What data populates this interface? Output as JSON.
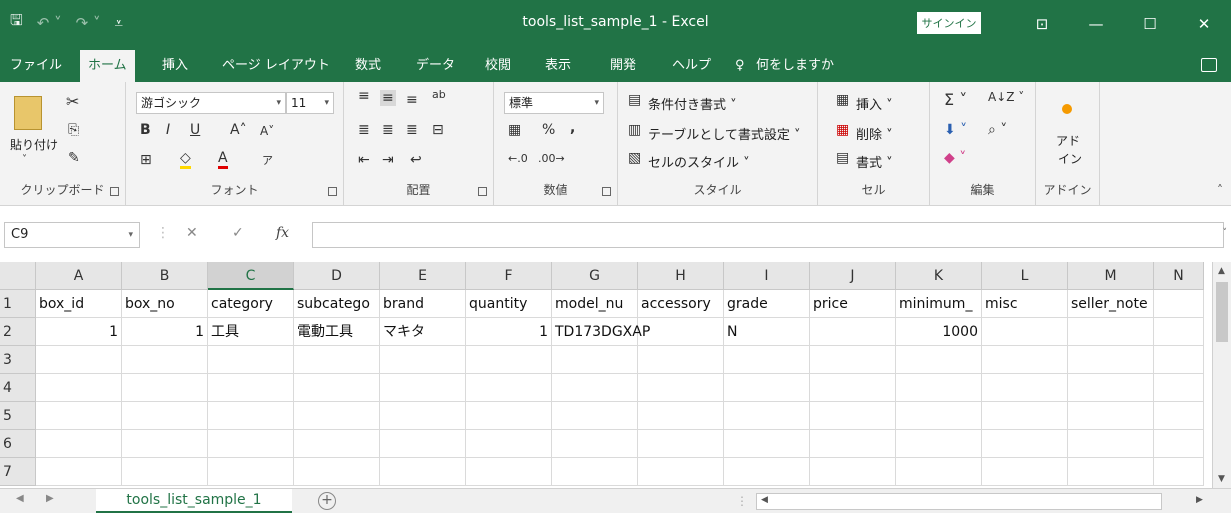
{
  "window": {
    "title": "tools_list_sample_1  -  Excel",
    "signin": "サインイン",
    "min": "—",
    "max": "☐",
    "close": "✕",
    "ribbon_display": "⊡"
  },
  "qat": {
    "save": "🖫",
    "undo": "↶ ˅",
    "redo": "↷ ˅",
    "customize": "⩡"
  },
  "tabs": {
    "file": "ファイル",
    "home": "ホーム",
    "insert": "挿入",
    "page_layout": "ページ レイアウト",
    "formulas": "数式",
    "data": "データ",
    "review": "校閲",
    "view": "表示",
    "developer": "開発",
    "help": "ヘルプ",
    "tell_me": "何をしますか"
  },
  "ribbon": {
    "clipboard": {
      "label": "クリップボード",
      "paste": "貼り付け"
    },
    "font": {
      "label": "フォント",
      "name": "游ゴシック",
      "size": "11"
    },
    "alignment": {
      "label": "配置"
    },
    "number": {
      "label": "数値",
      "format": "標準",
      "percent": "%",
      "comma": ","
    },
    "styles": {
      "label": "スタイル",
      "conditional": "条件付き書式 ˅",
      "as_table": "テーブルとして書式設定 ˅",
      "cell_styles": "セルのスタイル ˅"
    },
    "cells": {
      "label": "セル",
      "insert": "挿入 ˅",
      "delete": "削除 ˅",
      "format": "書式 ˅"
    },
    "editing": {
      "label": "編集"
    },
    "addins": {
      "label": "アドイン",
      "button_line1": "アド",
      "button_line2": "イン"
    }
  },
  "formula_bar": {
    "name_box": "C9",
    "cancel": "✕",
    "enter": "✓",
    "fx": "fx",
    "value": ""
  },
  "columns": [
    "A",
    "B",
    "C",
    "D",
    "E",
    "F",
    "G",
    "H",
    "I",
    "J",
    "K",
    "L",
    "M",
    "N"
  ],
  "rows": [
    "1",
    "2",
    "3",
    "4",
    "5",
    "6",
    "7"
  ],
  "cells": {
    "r1": [
      "box_id",
      "box_no",
      "category",
      "subcatego",
      "brand",
      "quantity",
      "model_nu",
      "accessory",
      "grade",
      "price",
      "minimum_",
      "misc",
      "seller_note",
      ""
    ],
    "r2": [
      "1",
      "1",
      "工具",
      "電動工具",
      "マキタ",
      "1",
      "TD173DGXAP",
      "",
      "N",
      "",
      "1000",
      "",
      "",
      ""
    ]
  },
  "sheet": {
    "tab": "tools_list_sample_1",
    "add": "+"
  }
}
